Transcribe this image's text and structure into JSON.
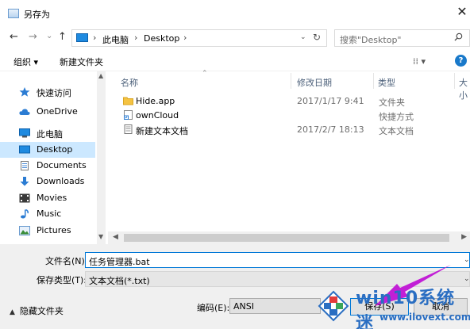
{
  "window": {
    "title": "另存为",
    "close_glyph": "✕"
  },
  "nav": {
    "back": "←",
    "forward": "→",
    "recent": "⌄",
    "up": "↑",
    "breadcrumb": [
      "此电脑",
      "Desktop"
    ],
    "separator": "›",
    "search_placeholder": "搜索\"Desktop\""
  },
  "commands": {
    "organize": "组织 ▾",
    "new_folder": "新建文件夹",
    "view": "⁞⁞ ▾",
    "help": "?"
  },
  "sidebar": {
    "items": [
      {
        "label": "快速访问",
        "icon": "star-icon"
      },
      {
        "label": "OneDrive",
        "icon": "cloud-icon"
      },
      {
        "label": "此电脑",
        "icon": "computer-icon"
      },
      {
        "label": "Desktop",
        "icon": "desktop-icon",
        "selected": true
      },
      {
        "label": "Documents",
        "icon": "documents-icon"
      },
      {
        "label": "Downloads",
        "icon": "downloads-icon"
      },
      {
        "label": "Movies",
        "icon": "movies-icon"
      },
      {
        "label": "Music",
        "icon": "music-icon"
      },
      {
        "label": "Pictures",
        "icon": "pictures-icon"
      }
    ]
  },
  "list": {
    "columns": [
      "名称",
      "修改日期",
      "类型",
      "大小"
    ],
    "rows": [
      {
        "name": "Hide.app",
        "date": "2017/1/17 9:41",
        "type": "文件夹",
        "icon": "folder-icon"
      },
      {
        "name": "ownCloud",
        "date": "",
        "type": "快捷方式",
        "icon": "shortcut-icon"
      },
      {
        "name": "新建文本文档",
        "date": "2017/2/7 18:13",
        "type": "文本文档",
        "icon": "text-file-icon"
      }
    ]
  },
  "form": {
    "filename_label": "文件名(N):",
    "filename_value": "任务管理器.bat",
    "filetype_label": "保存类型(T):",
    "filetype_value": "文本文档(*.txt)",
    "hide_folders": "隐藏文件夹",
    "encoding_label": "编码(E):",
    "encoding_value": "ANSI",
    "save": "保存(S)",
    "cancel": "取消"
  },
  "watermark": {
    "title": "win10系统迷",
    "url": "www.ilovext.com"
  },
  "colors": {
    "accent": "#0078d7",
    "selected": "#cce8ff",
    "arrow": "#c21fd6",
    "watermark": "#2a6ec2"
  }
}
